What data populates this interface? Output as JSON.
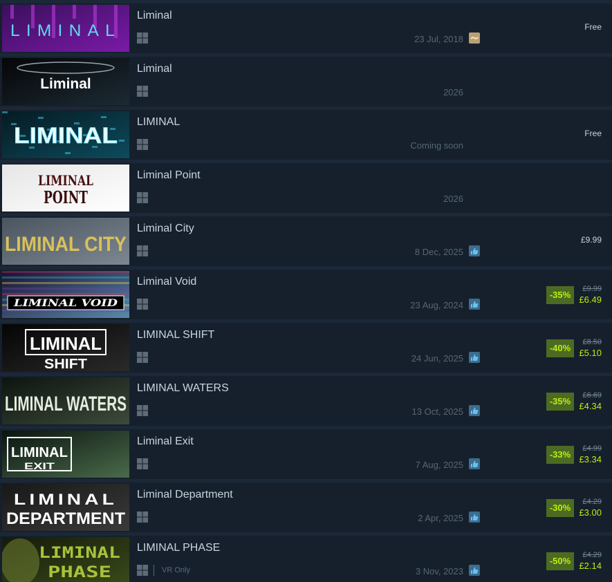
{
  "results": [
    {
      "title": "Liminal",
      "date": "23 Jul, 2018",
      "review": "mixed-review-icon",
      "price": "Free",
      "capsule": {
        "text": "LIMINAL",
        "bg": "#3a0f5c",
        "bg2": "#7a1aa8",
        "fg": "#5fd9f0",
        "style": "neon-spaced"
      }
    },
    {
      "title": "Liminal",
      "date": "2026",
      "review": "",
      "price": "",
      "capsule": {
        "text": "Liminal",
        "bg": "#050608",
        "bg2": "#1c2a33",
        "fg": "#ffffff",
        "style": "bold"
      }
    },
    {
      "title": "LIMINAL",
      "date": "Coming soon",
      "review": "",
      "price": "Free",
      "capsule": {
        "text": "LIMINAL",
        "bg": "#061a22",
        "bg2": "#0d4b5c",
        "fg": "#e8fbff",
        "style": "glow"
      }
    },
    {
      "title": "Liminal Point",
      "date": "2026",
      "review": "",
      "price": "",
      "capsule": {
        "text": "LIMINAL",
        "text2": "POINT",
        "bg": "#e6e6e6",
        "bg2": "#ffffff",
        "fg": "#5a1a1a",
        "style": "gothic"
      }
    },
    {
      "title": "Liminal City",
      "date": "8 Dec, 2025",
      "review": "positive-review-icon",
      "price": "£9.99",
      "capsule": {
        "text": "LIMINAL CITY",
        "bg": "#4b5560",
        "bg2": "#7d8791",
        "fg": "#d8c25a",
        "style": "condensed"
      }
    },
    {
      "title": "Liminal Void",
      "date": "23 Aug, 2024",
      "review": "positive-review-icon",
      "discount": "-35%",
      "orig_price": "£9.99",
      "final_price": "£6.49",
      "capsule": {
        "text": "LIMINAL VOID",
        "bg": "#1a1030",
        "bg2": "#5a8aa8",
        "fg": "#ffffff",
        "style": "glitch"
      }
    },
    {
      "title": "LIMINAL SHIFT",
      "date": "24 Jun, 2025",
      "review": "positive-review-icon",
      "discount": "-40%",
      "orig_price": "£8.50",
      "final_price": "£5.10",
      "capsule": {
        "text": "LIMINAL",
        "text2": "SHIFT",
        "bg": "#050505",
        "bg2": "#2a2a2a",
        "fg": "#ffffff",
        "style": "boxed"
      }
    },
    {
      "title": "LIMINAL WATERS",
      "date": "13 Oct, 2025",
      "review": "positive-review-icon",
      "discount": "-35%",
      "orig_price": "£6.69",
      "final_price": "£4.34",
      "capsule": {
        "text": "LIMINAL WATERS",
        "bg": "#0d1410",
        "bg2": "#3d4a3a",
        "fg": "#e6ece0",
        "style": "condensed"
      }
    },
    {
      "title": "Liminal Exit",
      "date": "7 Aug, 2025",
      "review": "positive-review-icon",
      "discount": "-33%",
      "orig_price": "£4.99",
      "final_price": "£3.34",
      "capsule": {
        "text": "LIMINAL",
        "text2": "EXIT",
        "bg": "#0a1410",
        "bg2": "#4a6a4a",
        "fg": "#ffffff",
        "style": "framed"
      }
    },
    {
      "title": "Liminal Department",
      "date": "2 Apr, 2025",
      "review": "positive-review-icon",
      "discount": "-30%",
      "orig_price": "£4.29",
      "final_price": "£3.00",
      "capsule": {
        "text": "LIMINAL",
        "text2": "DEPARTMENT",
        "bg": "#181818",
        "bg2": "#3a3a3a",
        "fg": "#ffffff",
        "style": "two-line"
      }
    },
    {
      "title": "LIMINAL PHASE",
      "date": "3 Nov, 2023",
      "review": "positive-review-icon",
      "vr": "VR Only",
      "discount": "-50%",
      "orig_price": "£4.29",
      "final_price": "£2.14",
      "capsule": {
        "text": "LIMINAL",
        "text2": "PHASE",
        "bg": "#141a0a",
        "bg2": "#3a4a1a",
        "fg": "#a8c23a",
        "style": "dotted"
      }
    }
  ],
  "platform_icon": "windows-icon",
  "colors": {
    "background": "#1b2838",
    "row": "#16202d",
    "title": "#c7d5e0",
    "date": "#556772",
    "discount_bg": "#4c6b22",
    "discount_fg": "#beee11",
    "review_positive": "#66c0f4",
    "review_mixed": "#b9a074"
  }
}
